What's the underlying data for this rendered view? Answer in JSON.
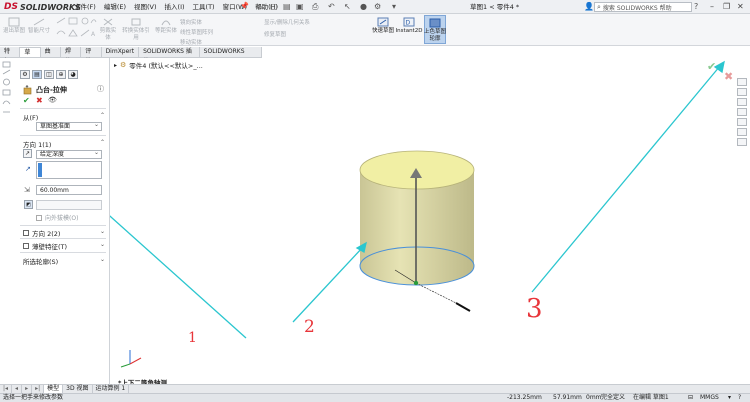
{
  "titlebar": {
    "logo_ds": "DS",
    "logo_text": "SOLIDWORKS",
    "menu": [
      "文件(F)",
      "编辑(E)",
      "视图(V)",
      "插入(I)",
      "工具(T)",
      "窗口(W)",
      "帮助(H)"
    ],
    "document_title": "草图1 < 零件4 *",
    "help_search_placeholder": "搜索 SOLIDWORKS 帮助"
  },
  "command_manager": {
    "grey_row1": [
      "显示/删除几何关系",
      "修复草图"
    ],
    "grey_items": [
      "退出草图",
      "智能尺寸",
      "剪裁实体",
      "转换实体引用",
      "等距实体",
      "镜向实体",
      "线性草图阵列",
      "移动实体"
    ],
    "quick_snaps_label": "快速草图",
    "instant2d_label": "Instant2D",
    "shaded_sketch_label": "上色草图轮廓"
  },
  "tabs": [
    "特征",
    "草图",
    "曲面",
    "焊件",
    "评估",
    "DimXpert",
    "SOLIDWORKS 插件",
    "SOLIDWORKS MBD"
  ],
  "tabs_active_index": 1,
  "tree_path": "零件4 (默认<<默认>_...",
  "property_manager": {
    "title": "凸台-拉伸",
    "from_label": "从(F)",
    "from_value": "草图基准面",
    "dir1_label": "方向 1(1)",
    "dir1_type": "给定深度",
    "depth_value": "60.00mm",
    "draft_outward_label": "向外拔模(O)",
    "dir2_label": "方向 2(2)",
    "thin_feature_label": "薄壁特征(T)",
    "selected_contours_label": "所选轮廓(S)"
  },
  "graphics": {
    "view_label": "*上下二等角轴测",
    "annotations": [
      "1",
      "2",
      "3"
    ],
    "annotation_color": "#e8363b",
    "arrow_color": "#2bc6cf",
    "cylinder_top": "#f2f0a0",
    "cylinder_side": "#dcd8a6"
  },
  "bottom_tabs": [
    "模型",
    "3D 视图",
    "运动算例 1"
  ],
  "bottom_tabs_active_index": 0,
  "status": {
    "left": "选择一把手来修改参数",
    "x": "-213.25mm",
    "y": "57.91mm",
    "z": "0mm",
    "state": "完全定义",
    "editing": "在编辑 草图1"
  }
}
